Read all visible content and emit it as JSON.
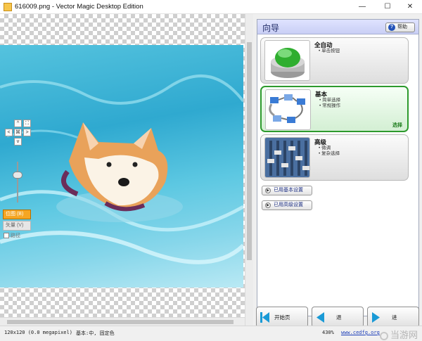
{
  "window": {
    "title": "616009.png - Vector Magic Desktop Edition",
    "controls": {
      "minimize": "—",
      "maximize": "☐",
      "close": "✕"
    }
  },
  "canvas": {
    "nav_buttons": {
      "up": "^",
      "down": "v",
      "left": "<",
      "right": ">",
      "center": "⌘",
      "fit": "⛶",
      "actual": "⛶"
    },
    "modes": {
      "bitmap": "位图 (B)",
      "vector": "矢量 (V)",
      "paths": "路径"
    }
  },
  "wizard": {
    "title": "向导",
    "help_label": "帮助",
    "options": [
      {
        "title": "全自动",
        "bullets": [
          "单击按钮"
        ],
        "selected": false
      },
      {
        "title": "基本",
        "bullets": [
          "简单选择",
          "常规操作"
        ],
        "selected": true,
        "select_label": "选择"
      },
      {
        "title": "高级",
        "bullets": [
          "微调",
          "复杂选择"
        ],
        "selected": false
      }
    ],
    "advanced_buttons": [
      "已用基本设置",
      "已用高级设置"
    ]
  },
  "bottom_buttons": {
    "start": "开始页",
    "back": "退",
    "forward": "进"
  },
  "status": {
    "size": "120x120 (0.0 megapixel)",
    "mode": "基本:中, 固定色",
    "zoom": "430%",
    "link": "www.cedfg.org",
    "watermark": "当游网"
  }
}
